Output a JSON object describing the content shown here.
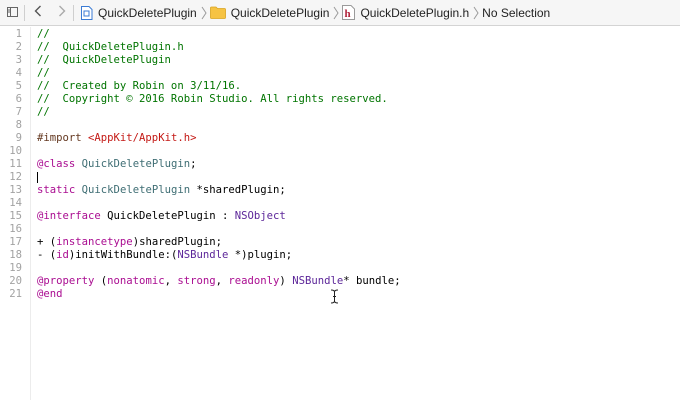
{
  "jumpbar": {
    "icons": [
      "related-items-icon",
      "back-chevron-icon",
      "forward-chevron-icon",
      "xcode-project-icon",
      "folder-icon",
      "header-file-icon",
      "breadcrumb-chevron-icon"
    ],
    "crumbs": [
      {
        "label": "QuickDeletePlugin",
        "icon": "xcode-project-icon"
      },
      {
        "label": "QuickDeletePlugin",
        "icon": "folder-icon"
      },
      {
        "label": "QuickDeletePlugin.h",
        "icon": "header-file-icon",
        "icon_glyph": "h"
      },
      {
        "label": "No Selection"
      }
    ]
  },
  "editor": {
    "line_numbers": [
      "1",
      "2",
      "3",
      "4",
      "5",
      "6",
      "7",
      "8",
      "9",
      "10",
      "11",
      "12",
      "13",
      "14",
      "15",
      "16",
      "17",
      "18",
      "19",
      "20",
      "21"
    ],
    "lines": [
      [
        {
          "t": "//",
          "c": "comment"
        }
      ],
      [
        {
          "t": "//  QuickDeletePlugin.h",
          "c": "comment"
        }
      ],
      [
        {
          "t": "//  QuickDeletePlugin",
          "c": "comment"
        }
      ],
      [
        {
          "t": "//",
          "c": "comment"
        }
      ],
      [
        {
          "t": "//  Created by Robin on 3/11/16.",
          "c": "comment"
        }
      ],
      [
        {
          "t": "//  Copyright © 2016 Robin Studio. All rights reserved.",
          "c": "comment"
        }
      ],
      [
        {
          "t": "//",
          "c": "comment"
        }
      ],
      [],
      [
        {
          "t": "#import ",
          "c": "pp"
        },
        {
          "t": "<AppKit/AppKit.h>",
          "c": "str"
        }
      ],
      [],
      [
        {
          "t": "@class",
          "c": "kw"
        },
        {
          "t": " "
        },
        {
          "t": "QuickDeletePlugin",
          "c": "type"
        },
        {
          "t": ";"
        }
      ],
      [],
      [
        {
          "t": "static",
          "c": "kw"
        },
        {
          "t": " "
        },
        {
          "t": "QuickDeletePlugin",
          "c": "type"
        },
        {
          "t": " *sharedPlugin;"
        }
      ],
      [],
      [
        {
          "t": "@interface",
          "c": "kw"
        },
        {
          "t": " QuickDeletePlugin : "
        },
        {
          "t": "NSObject",
          "c": "cls"
        }
      ],
      [],
      [
        {
          "t": "+ ("
        },
        {
          "t": "instancetype",
          "c": "kw"
        },
        {
          "t": ")sharedPlugin;"
        }
      ],
      [
        {
          "t": "- ("
        },
        {
          "t": "id",
          "c": "kw"
        },
        {
          "t": ")initWithBundle:("
        },
        {
          "t": "NSBundle",
          "c": "cls"
        },
        {
          "t": " *)plugin;"
        }
      ],
      [],
      [
        {
          "t": "@property",
          "c": "kw"
        },
        {
          "t": " ("
        },
        {
          "t": "nonatomic",
          "c": "kw"
        },
        {
          "t": ", "
        },
        {
          "t": "strong",
          "c": "kw"
        },
        {
          "t": ", "
        },
        {
          "t": "readonly",
          "c": "kw"
        },
        {
          "t": ") "
        },
        {
          "t": "NSBundle",
          "c": "cls"
        },
        {
          "t": "* bundle;"
        }
      ],
      [
        {
          "t": "@end",
          "c": "kw"
        }
      ]
    ]
  },
  "colors": {
    "comment": "#007400",
    "preprocessor": "#643820",
    "string": "#c41a16",
    "keyword": "#aa0d91",
    "project_type": "#3f6e74",
    "system_class": "#5c2699",
    "line_number": "#a2a2a2",
    "folder": "#f6c343",
    "header_icon": "#b0223a"
  }
}
